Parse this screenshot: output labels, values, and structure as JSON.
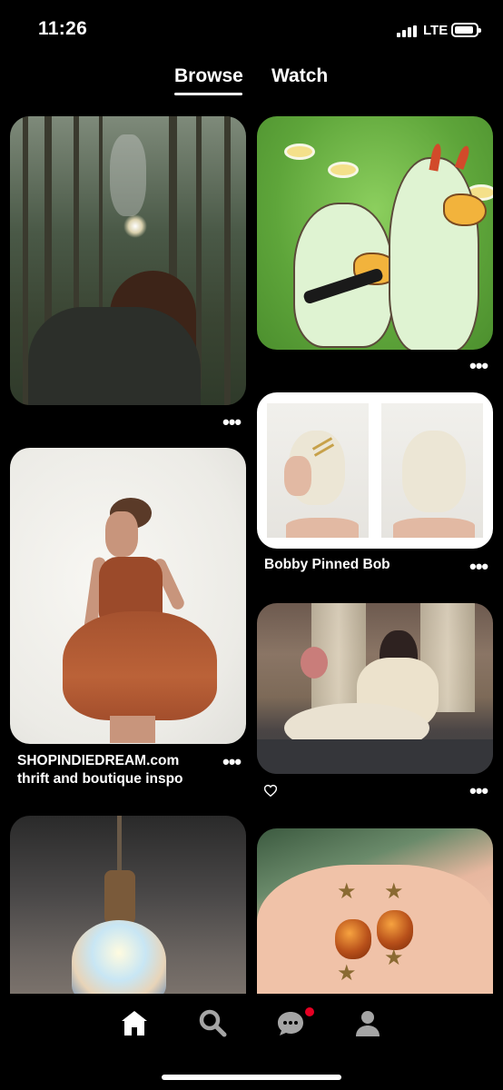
{
  "status_bar": {
    "time": "11:26",
    "network": "LTE"
  },
  "tabs": {
    "browse": "Browse",
    "watch": "Watch"
  },
  "pins": {
    "p1": {
      "menu": "•••"
    },
    "p2": {
      "menu": "•••"
    },
    "p3": {
      "caption": "Bobby Pinned Bob",
      "menu": "•••"
    },
    "p4": {
      "caption_line1": "SHOPINDIEDREAM.com",
      "caption_line2": "thrift and boutique inspo",
      "menu": "•••"
    },
    "p5": {
      "menu": "•••"
    }
  },
  "icons": {
    "home": "home-icon",
    "search": "search-icon",
    "messages": "messages-icon",
    "profile": "profile-icon",
    "heart": "heart-icon"
  },
  "colors": {
    "background": "#000000",
    "notification_dot": "#e60023",
    "text": "#ffffff"
  }
}
